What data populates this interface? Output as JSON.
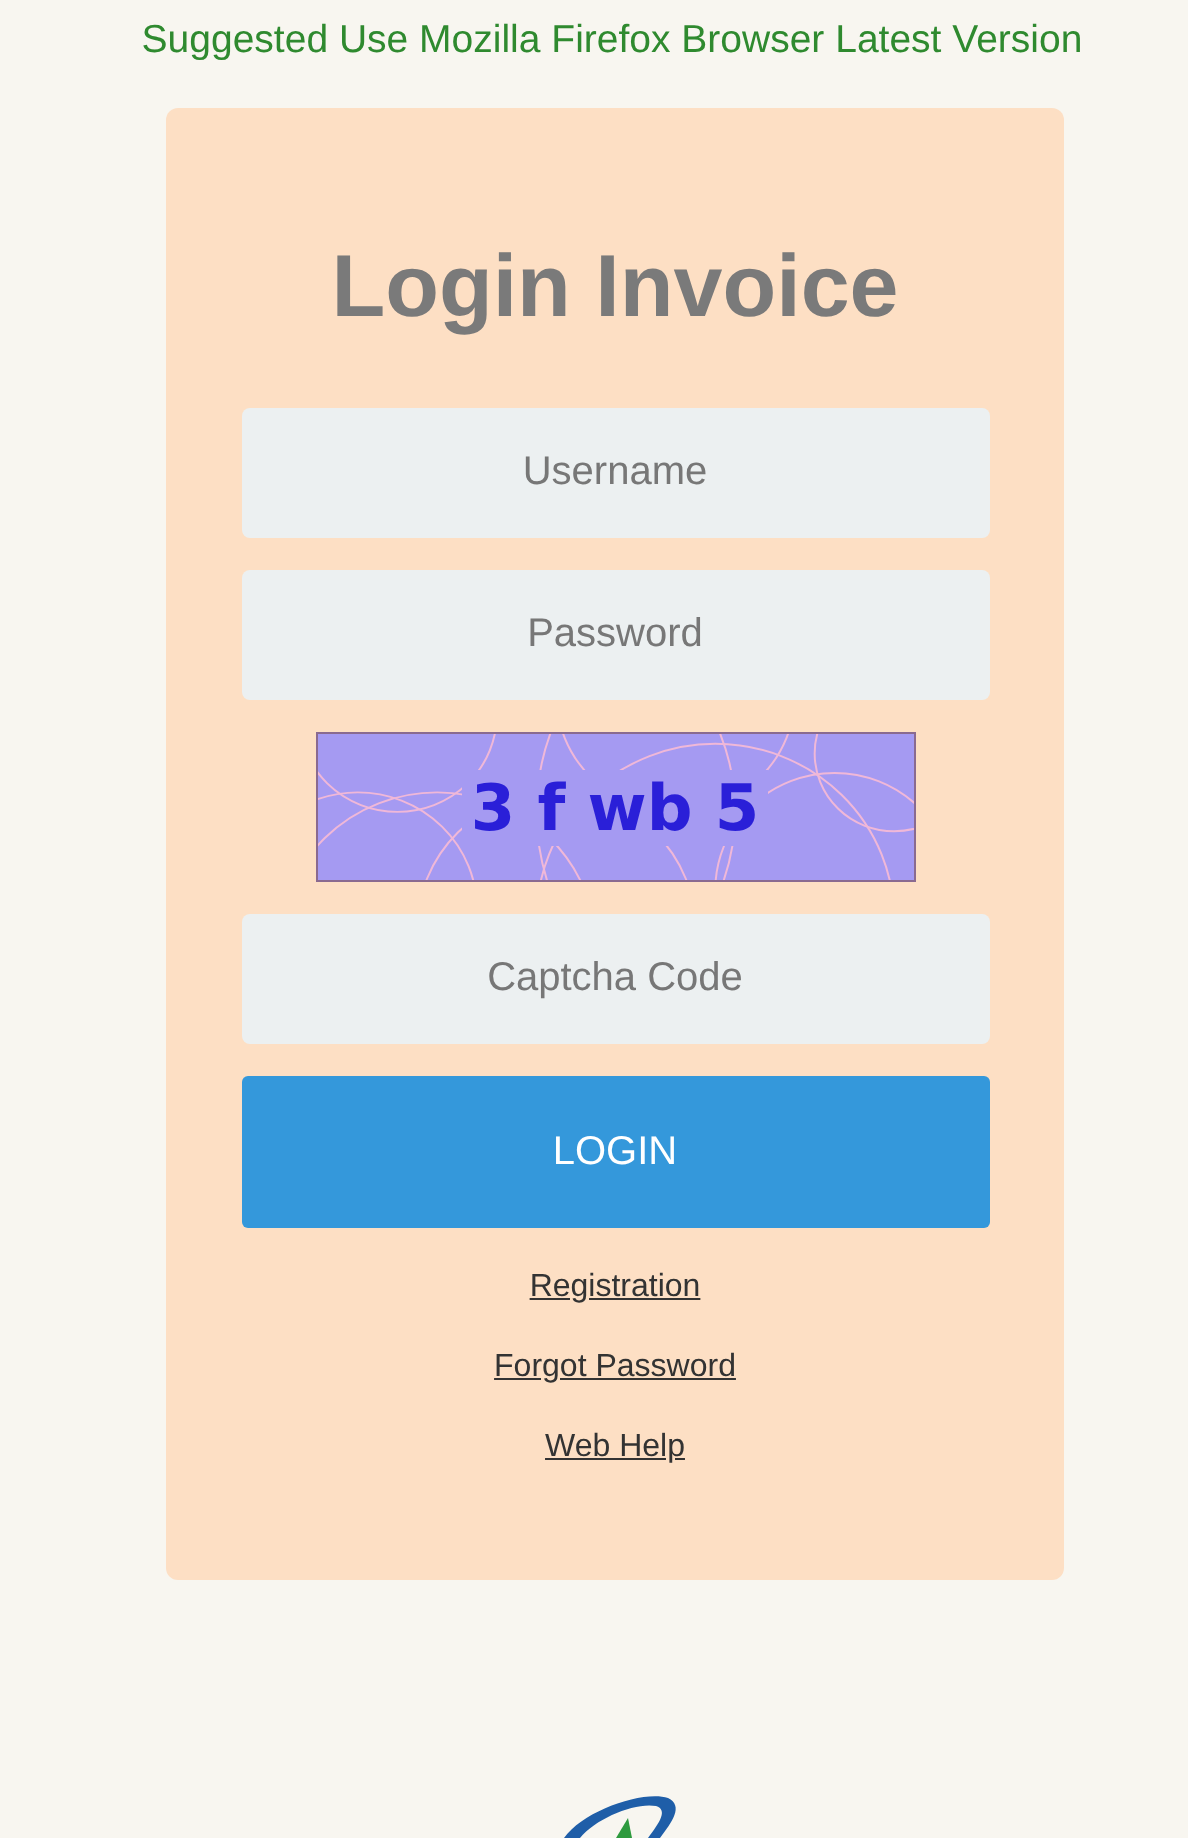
{
  "notice": "Suggested Use Mozilla Firefox Browser Latest Version",
  "title": "Login Invoice",
  "username_field": {
    "placeholder": "Username"
  },
  "password_field": {
    "placeholder": "Password"
  },
  "captcha": {
    "code": "3 f wb 5"
  },
  "captcha_field": {
    "placeholder": "Captcha Code"
  },
  "login_button": "LOGIN",
  "links": [
    "Registration",
    "Forgot Password",
    "Web Help"
  ]
}
